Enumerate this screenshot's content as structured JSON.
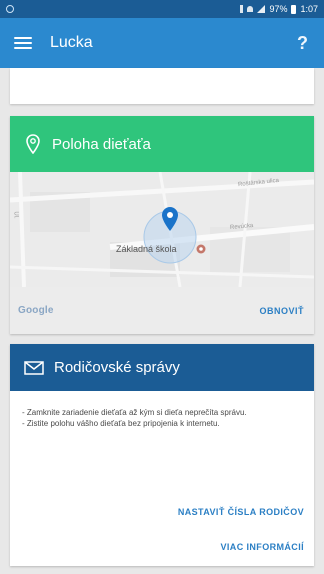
{
  "status_bar": {
    "time": "1:07",
    "battery": "97%"
  },
  "app_bar": {
    "title": "Lucka",
    "help_label": "?"
  },
  "location_card": {
    "title": "Poloha dieťaťa",
    "map": {
      "place_label": "Základná škola",
      "provider_logo": "Google"
    },
    "refresh_label": "OBNOVIŤ"
  },
  "messages_card": {
    "title": "Rodičovské správy",
    "bullets": [
      "- Zamknite zariadenie dieťaťa až kým si dieťa neprečíta správu.",
      "- Zistite polohu vášho dieťaťa bez pripojenia k internetu."
    ],
    "set_numbers_label": "NASTAVIŤ ČÍSLA RODIČOV",
    "more_info_label": "VIAC INFORMÁCIÍ"
  },
  "icons": {
    "menu": "hamburger-menu-icon",
    "help": "question-mark-icon",
    "location": "location-pin-icon",
    "messages": "envelope-icon",
    "map_marker": "map-marker-icon",
    "place": "place-icon"
  },
  "colors": {
    "status_bar": "#1b5c95",
    "app_bar": "#2b89cf",
    "location_header": "#2fc57c",
    "messages_header": "#1b5c95",
    "link": "#2b7fc4",
    "map_marker": "#1a73c9"
  }
}
